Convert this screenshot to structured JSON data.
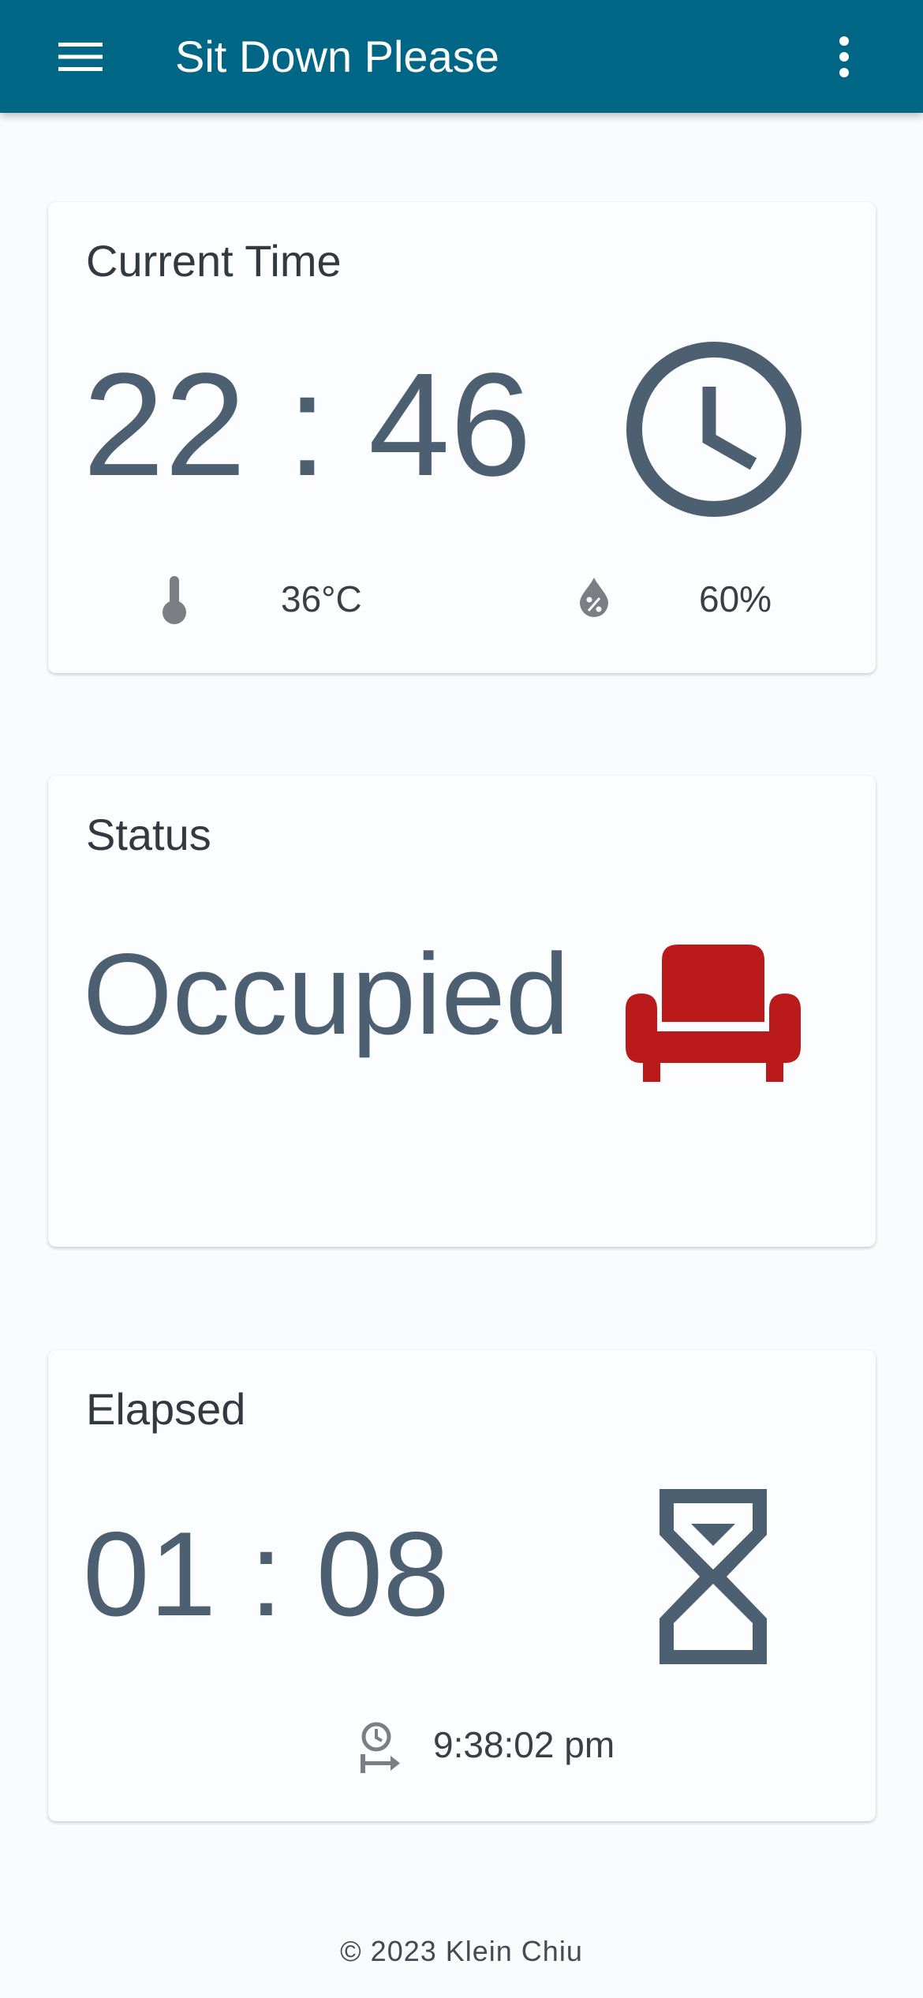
{
  "app_bar": {
    "title": "Sit Down Please",
    "background": "#006685",
    "menu_icon": "hamburger-menu-icon",
    "more_icon": "more-vertical-icon"
  },
  "current_time_card": {
    "title": "Current Time",
    "time": "22 : 46",
    "icon": "clock-icon",
    "temperature": "36°C",
    "temperature_icon": "thermometer-icon",
    "humidity": "60%",
    "humidity_icon": "humidity-drop-icon"
  },
  "status_card": {
    "title": "Status",
    "status": "Occupied",
    "icon": "sofa-icon",
    "status_color": "#bb1a1b"
  },
  "elapsed_card": {
    "title": "Elapsed",
    "elapsed": "01 : 08",
    "icon": "hourglass-icon",
    "start_time": "9:38:02 pm",
    "start_time_icon": "clock-start-icon"
  },
  "footer": {
    "copyright": "© 2023 Klein Chiu"
  },
  "colors": {
    "value_text": "#4c6071",
    "secondary_icon": "#7b7e82"
  }
}
